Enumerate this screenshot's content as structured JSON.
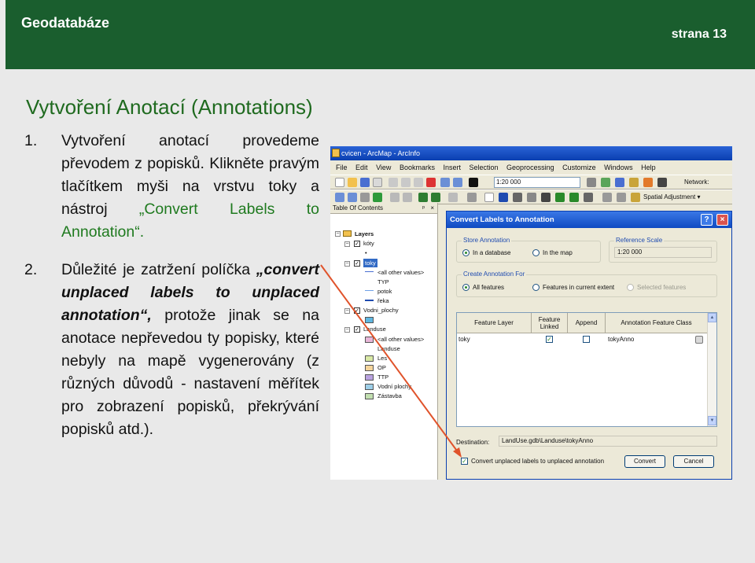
{
  "header": {
    "course": "Geodatabáze",
    "page": "strana 13"
  },
  "slide": {
    "title": "Vytvoření Anotací (Annotations)",
    "item1": {
      "num": "1.",
      "text": "Vytvoření anotací provedeme převodem z popisků. Klikněte pravým tlačítkem myši na vrstvu toky a nástroj ",
      "highlight": "„Convert Labels to Annotation“."
    },
    "item2": {
      "num": "2.",
      "text1": "Důležité je zatržení políčka ",
      "highlight": "„convert unplaced labels to unplaced annotation“,",
      "text2": " protože jinak se na anotace nepřevedou ty popisky, které nebyly na mapě vygenerovány (z různých důvodů - nastavení měřítek pro zobrazení popisků, překrývání popisků atd.)."
    }
  },
  "arcmap": {
    "window_title": "cvicen - ArcMap - ArcInfo",
    "menus": [
      "File",
      "Edit",
      "View",
      "Bookmarks",
      "Insert",
      "Selection",
      "Geoprocessing",
      "Customize",
      "Windows",
      "Help"
    ],
    "scale": "1:20 000",
    "network_label": "Network:",
    "spatial_adjustment": "Spatial Adjustment ▾",
    "toc": {
      "title": "Table Of Contents",
      "layers": "Layers",
      "koty": "kóty",
      "toky": "toky",
      "all_other": "<all other values>",
      "typ": "TYP",
      "potok": "potok",
      "reka": "řeka",
      "vodni_plochy": "Vodni_plochy",
      "landuse": "Landuse",
      "all_other2": "<all other values>",
      "landuse_field": "Landuse",
      "les": "Les",
      "op": "OP",
      "ttp": "TTP",
      "vodni": "Vodní plochy",
      "zastavba": "Zástavba"
    },
    "dialog": {
      "title": "Convert Labels to Annotation",
      "store_group": "Store Annotation",
      "in_database": "In a database",
      "in_map": "In the map",
      "ref_group": "Reference Scale",
      "ref_scale": "1:20 000",
      "create_group": "Create Annotation For",
      "all_features": "All features",
      "features_extent": "Features in current extent",
      "selected_features": "Selected features",
      "columns": [
        "Feature Layer",
        "Feature Linked",
        "Append",
        "Annotation Feature Class"
      ],
      "row": {
        "layer": "toky",
        "linked": "✓",
        "append": "",
        "annotation": "tokyAnno"
      },
      "destination_label": "Destination:",
      "destination": "LandUse.gdb\\Landuse\\tokyAnno",
      "convert_unplaced": "Convert unplaced labels to unplaced annotation",
      "convert_btn": "Convert",
      "cancel_btn": "Cancel"
    }
  },
  "colors": {
    "header_bg": "#1a5e2e",
    "title_green": "#1f6a1f",
    "arrow_red": "#e0532b"
  }
}
